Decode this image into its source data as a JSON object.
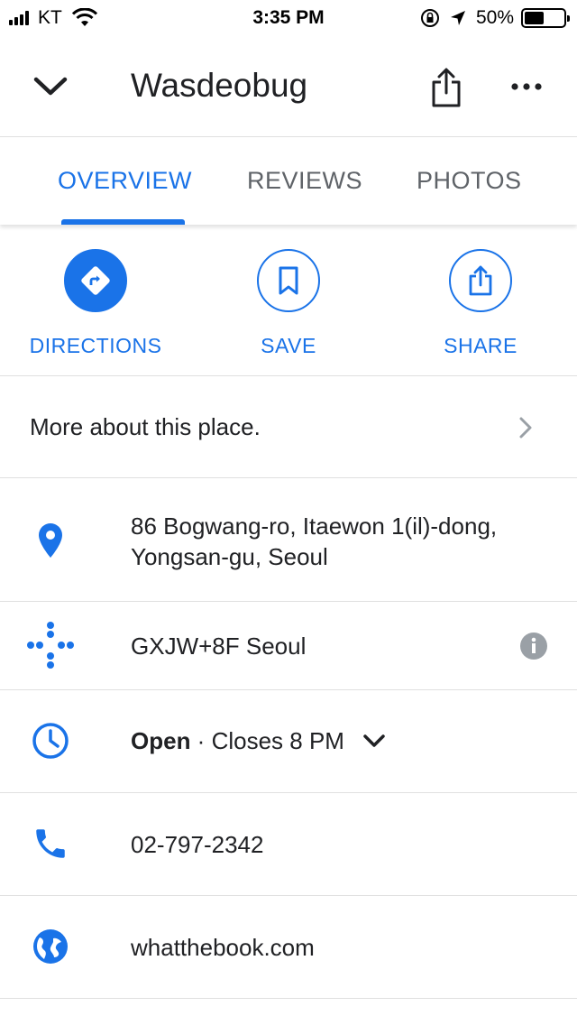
{
  "status_bar": {
    "carrier": "KT",
    "time": "3:35 PM",
    "battery": "50%",
    "battery_level": 0.5
  },
  "header": {
    "title": "Wasdeobug",
    "back_icon": "chevron-down-icon",
    "share_icon": "share-icon",
    "more_icon": "more-horizontal-icon"
  },
  "tabs": [
    {
      "label": "OVERVIEW",
      "active": true
    },
    {
      "label": "REVIEWS",
      "active": false
    },
    {
      "label": "PHOTOS",
      "active": false
    }
  ],
  "actions": [
    {
      "label": "DIRECTIONS",
      "icon": "directions-icon"
    },
    {
      "label": "SAVE",
      "icon": "bookmark-icon"
    },
    {
      "label": "SHARE",
      "icon": "share-icon"
    }
  ],
  "more_about": "More about this place.",
  "address": {
    "line1": "86 Bogwang-ro, Itaewon 1(il)-dong,",
    "line2": "Yongsan-gu, Seoul"
  },
  "plus_code": "GXJW+8F Seoul",
  "hours": {
    "status": "Open",
    "separator": " · ",
    "detail": "Closes 8 PM"
  },
  "phone": "02-797-2342",
  "website": "whatthebook.com",
  "colors": {
    "accent": "#1a73e8",
    "text": "#202124",
    "secondary": "#5f6368",
    "divider": "#e0e0e0"
  }
}
